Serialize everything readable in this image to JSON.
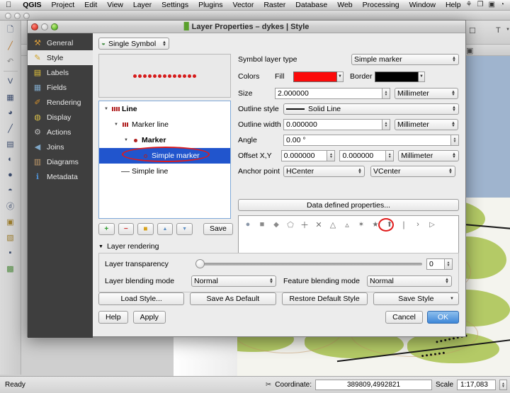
{
  "menubar": {
    "apple": "",
    "items": [
      {
        "label": "QGIS",
        "bold": true
      },
      {
        "label": "Project"
      },
      {
        "label": "Edit"
      },
      {
        "label": "View"
      },
      {
        "label": "Layer"
      },
      {
        "label": "Settings"
      },
      {
        "label": "Plugins"
      },
      {
        "label": "Vector"
      },
      {
        "label": "Raster"
      },
      {
        "label": "Database"
      },
      {
        "label": "Web"
      },
      {
        "label": "Processing"
      },
      {
        "label": "Window"
      },
      {
        "label": "Help"
      }
    ],
    "right_icons": [
      "dropbox-icon",
      "screen-share-icon",
      "display-icon",
      "time-machine-icon",
      "bluetooth-icon",
      "wifi-icon"
    ],
    "right_glyphs": [
      "⚘",
      "❐",
      "▣",
      "◔",
      "✶",
      "◜"
    ]
  },
  "dialog": {
    "title": "Layer Properties – dykes | Style",
    "title_icon": "qgis-layer-icon",
    "sidebar": {
      "items": [
        {
          "label": "General",
          "icon": "wrench-icon",
          "glyph": "⚒"
        },
        {
          "label": "Style",
          "icon": "brush-icon",
          "glyph": "✎"
        },
        {
          "label": "Labels",
          "icon": "abc-label-icon",
          "glyph": "▤"
        },
        {
          "label": "Fields",
          "icon": "table-icon",
          "glyph": "▦"
        },
        {
          "label": "Rendering",
          "icon": "broom-icon",
          "glyph": "✐"
        },
        {
          "label": "Display",
          "icon": "speech-bubble-icon",
          "glyph": "◍"
        },
        {
          "label": "Actions",
          "icon": "gear-play-icon",
          "glyph": "⚙"
        },
        {
          "label": "Joins",
          "icon": "join-icon",
          "glyph": "◀"
        },
        {
          "label": "Diagrams",
          "icon": "chart-icon",
          "glyph": "▥"
        },
        {
          "label": "Metadata",
          "icon": "info-icon",
          "glyph": "ℹ"
        }
      ],
      "active_index": 1
    },
    "renderer": {
      "label": "Single Symbol",
      "icon": "single-symbol-icon"
    },
    "symbol_preview": {
      "marker_count": 13,
      "marker_color": "#d61a1a"
    },
    "symbol_tree": [
      {
        "label": "Line",
        "depth": 0,
        "bold": true,
        "glyph": "marker-line-icon",
        "expanded": true,
        "selected": false
      },
      {
        "label": "Marker line",
        "depth": 1,
        "bold": false,
        "glyph": "marker-line-icon",
        "expanded": true,
        "selected": false
      },
      {
        "label": "Marker",
        "depth": 2,
        "bold": true,
        "glyph": "dot-icon",
        "expanded": true,
        "selected": false
      },
      {
        "label": "Simple marker",
        "depth": 3,
        "bold": false,
        "glyph": "circle-outline-icon",
        "expanded": false,
        "selected": true
      },
      {
        "label": "Simple line",
        "depth": 1,
        "bold": false,
        "glyph": "dash-icon",
        "expanded": false,
        "selected": false
      }
    ],
    "tree_toolbar": {
      "add_label": "+",
      "remove_label": "−",
      "lock_label": "■",
      "up_label": "▲",
      "down_label": "▼",
      "save_label": "Save",
      "icons": [
        "add-symbol-layer-icon",
        "remove-symbol-layer-icon",
        "lock-icon",
        "move-up-icon",
        "move-down-icon"
      ]
    },
    "properties": {
      "symbol_layer_type_label": "Symbol layer type",
      "symbol_layer_type_value": "Simple marker",
      "colors_label": "Colors",
      "fill_label": "Fill",
      "fill_color": "#fb0a0a",
      "border_label": "Border",
      "border_color": "#000000",
      "size_label": "Size",
      "size_value": "2.000000",
      "size_unit": "Millimeter",
      "outline_style_label": "Outline style",
      "outline_style_value": "Solid Line",
      "outline_width_label": "Outline width",
      "outline_width_value": "0.000000",
      "outline_width_unit": "Millimeter",
      "angle_label": "Angle",
      "angle_value": "0.00 °",
      "offset_label": "Offset X,Y",
      "offset_x": "0.000000",
      "offset_y": "0.000000",
      "offset_unit": "Millimeter",
      "anchor_label": "Anchor point",
      "anchor_h": "HCenter",
      "anchor_v": "VCenter",
      "data_defined_label": "Data defined properties..."
    },
    "marker_palette": {
      "selected_index": 13,
      "markers": [
        {
          "name": "circle-marker",
          "glyph": "●"
        },
        {
          "name": "square-marker",
          "glyph": "■"
        },
        {
          "name": "diamond-marker",
          "glyph": "◆"
        },
        {
          "name": "pentagon-marker",
          "glyph": "⬠"
        },
        {
          "name": "cross-marker",
          "glyph": "＋"
        },
        {
          "name": "x-marker",
          "glyph": "✕"
        },
        {
          "name": "triangle-marker",
          "glyph": "△"
        },
        {
          "name": "equilateral-triangle-marker",
          "glyph": "▵"
        },
        {
          "name": "star-marker",
          "glyph": "✶"
        },
        {
          "name": "regular-star-marker",
          "glyph": "★"
        },
        {
          "name": "arrow-marker",
          "glyph": "⬆"
        },
        {
          "name": "line-marker",
          "glyph": "❘"
        },
        {
          "name": "half-arc-marker",
          "glyph": "›"
        },
        {
          "name": "arrowhead-marker",
          "glyph": "▷"
        }
      ]
    },
    "layer_rendering": {
      "section_label": "Layer rendering",
      "transparency_label": "Layer transparency",
      "transparency_value": "0",
      "layer_blend_label": "Layer blending mode",
      "layer_blend_value": "Normal",
      "feature_blend_label": "Feature blending mode",
      "feature_blend_value": "Normal"
    },
    "style_buttons": [
      {
        "label": "Load Style...",
        "name": "load-style-button",
        "caret": false
      },
      {
        "label": "Save As Default",
        "name": "save-as-default-button",
        "caret": false
      },
      {
        "label": "Restore Default Style",
        "name": "restore-default-style-button",
        "caret": false
      },
      {
        "label": "Save Style",
        "name": "save-style-button",
        "caret": true
      }
    ],
    "footer": {
      "help_label": "Help",
      "apply_label": "Apply",
      "cancel_label": "Cancel",
      "ok_label": "OK"
    }
  },
  "statusbar": {
    "ready_label": "Ready",
    "render_icon": "render-icon",
    "coordinate_label": "Coordinate:",
    "coordinate_value": "389809,4992821",
    "scale_label": "Scale",
    "scale_value": "1:17,083"
  },
  "toolbar": {
    "left_icons": [
      "new-project-icon",
      "open-project-icon",
      "undo-icon",
      "add-vector-layer-icon",
      "add-raster-layer-icon",
      "add-mesh-layer-icon",
      "add-delimited-text-layer-icon",
      "add-spatialite-layer-icon",
      "add-postgis-layer-icon",
      "add-wms-layer-icon",
      "add-wcs-layer-icon",
      "add-wfs-layer-icon",
      "new-shapefile-icon",
      "new-spatialite-icon",
      "new-memory-layer-icon",
      "add-virtual-layer-icon"
    ],
    "left_glyphs": [
      "□",
      "╱",
      "↶",
      "V",
      "▦",
      "◑",
      "╱",
      "▤",
      "◐",
      "●",
      "◓",
      "Ⓥ",
      "▣",
      "▧",
      "▫",
      "▩"
    ]
  },
  "colors": {
    "accent": "#2155cd",
    "annotation": "#e01b1b",
    "fill": "#fb0a0a",
    "water": "#9fb4ce",
    "vegetation": "#a8c24e"
  }
}
